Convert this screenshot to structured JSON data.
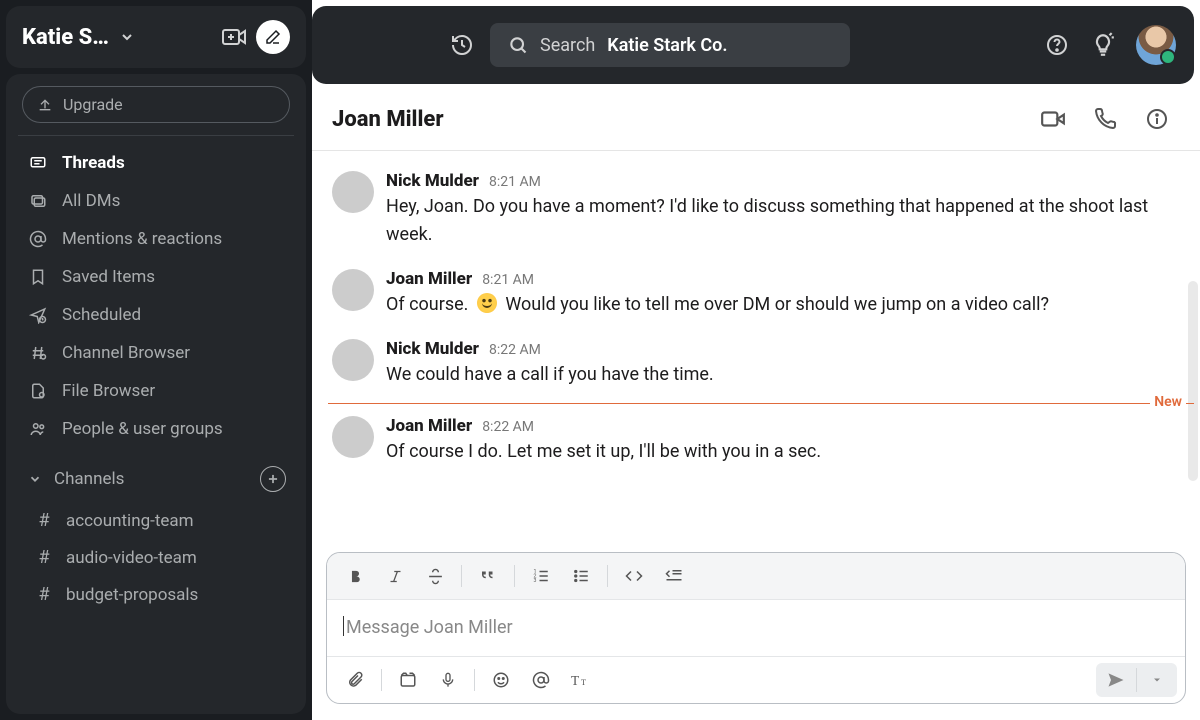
{
  "workspace": {
    "name": "Katie Stark Co.",
    "name_truncated": "Katie S…"
  },
  "upgrade": {
    "label": "Upgrade"
  },
  "nav": {
    "items": [
      {
        "id": "threads",
        "label": "Threads",
        "icon": "threads-icon",
        "active": true
      },
      {
        "id": "dms",
        "label": "All DMs",
        "icon": "all-dms-icon",
        "active": false
      },
      {
        "id": "mentions",
        "label": "Mentions & reactions",
        "icon": "mentions-icon",
        "active": false
      },
      {
        "id": "saved",
        "label": "Saved Items",
        "icon": "saved-icon",
        "active": false
      },
      {
        "id": "scheduled",
        "label": "Scheduled",
        "icon": "scheduled-icon",
        "active": false
      },
      {
        "id": "chbrowser",
        "label": "Channel Browser",
        "icon": "channel-browser-icon",
        "active": false
      },
      {
        "id": "files",
        "label": "File Browser",
        "icon": "file-browser-icon",
        "active": false
      },
      {
        "id": "people",
        "label": "People & user groups",
        "icon": "people-icon",
        "active": false
      }
    ]
  },
  "channels": {
    "header": "Channels",
    "items": [
      {
        "name": "accounting-team"
      },
      {
        "name": "audio-video-team"
      },
      {
        "name": "budget-proposals"
      }
    ]
  },
  "search": {
    "label": "Search",
    "context": "Katie Stark Co."
  },
  "conversation": {
    "title": "Joan Miller",
    "new_divider_label": "New",
    "messages": [
      {
        "author": "Nick Mulder",
        "time": "8:21 AM",
        "avatar": "nick",
        "text": "Hey, Joan. Do you have a moment? I'd like to discuss something that happened at the shoot last week."
      },
      {
        "author": "Joan Miller",
        "time": "8:21 AM",
        "avatar": "joan",
        "text_before": "Of course. ",
        "emoji": "slightly-smiling-face",
        "text_after": " Would you like to tell me over DM or should we jump on a video call?"
      },
      {
        "author": "Nick Mulder",
        "time": "8:22 AM",
        "avatar": "nick",
        "text": "We could have a call if you have the time."
      },
      {
        "author": "Joan Miller",
        "time": "8:22 AM",
        "avatar": "joan",
        "text": "Of course I do. Let me set it up, I'll be with you in a sec."
      }
    ]
  },
  "composer": {
    "placeholder": "Message Joan Miller"
  }
}
